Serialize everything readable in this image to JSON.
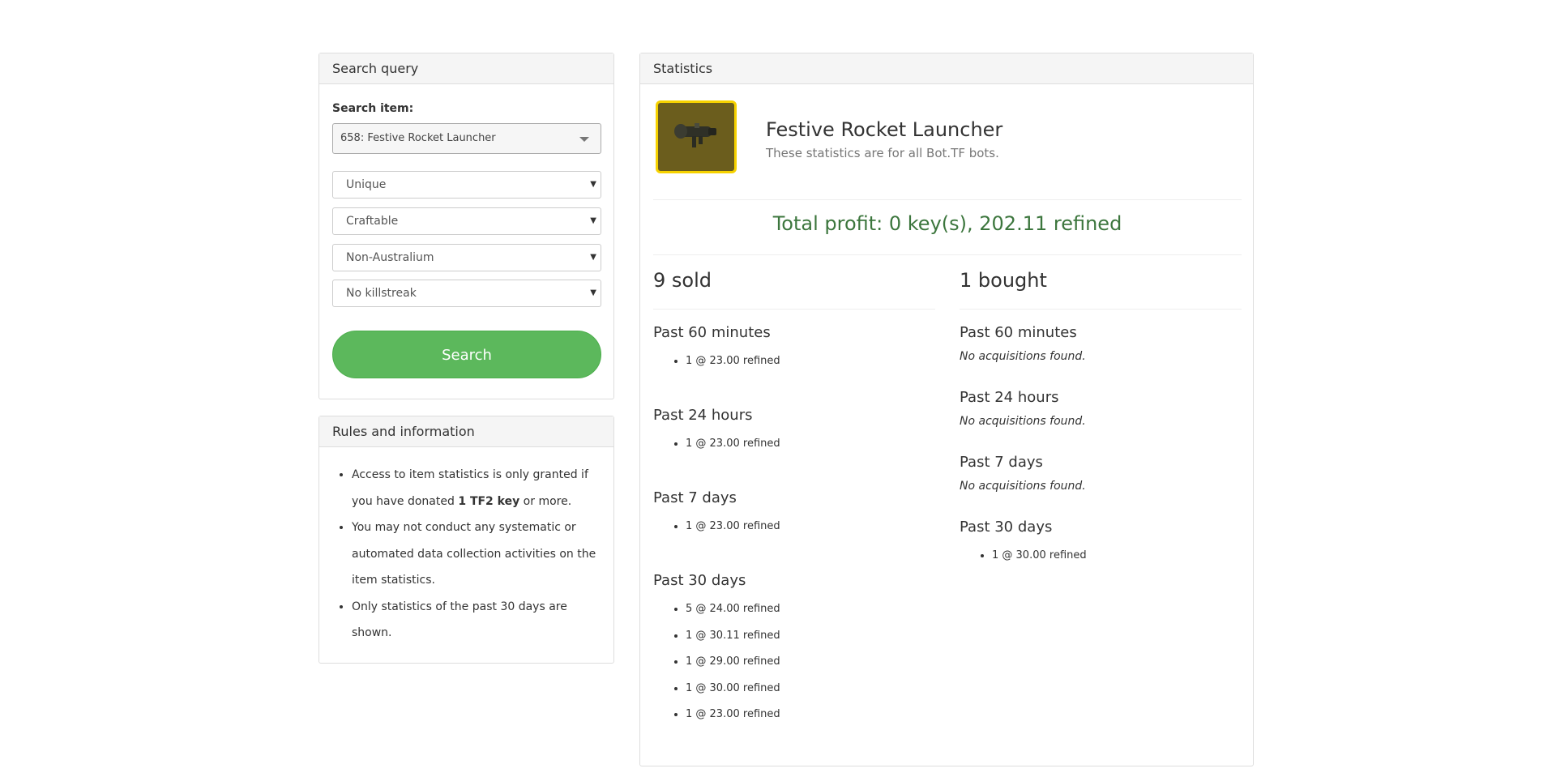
{
  "search_panel": {
    "heading": "Search query",
    "item_label": "Search item:",
    "item_value": "658: Festive Rocket Launcher",
    "quality": "Unique",
    "craftable": "Craftable",
    "australium": "Non-Australium",
    "killstreak": "No killstreak",
    "search_button": "Search"
  },
  "rules_panel": {
    "heading": "Rules and information",
    "rule1_pre": "Access to item statistics is only granted if you have donated ",
    "rule1_bold": "1 TF2 key",
    "rule1_post": " or more.",
    "rule2": "You may not conduct any systematic or automated data collection activities on the item statistics.",
    "rule3": "Only statistics of the past 30 days are shown."
  },
  "stats_panel": {
    "heading": "Statistics",
    "item_name": "Festive Rocket Launcher",
    "subtitle": "These statistics are for all Bot.TF bots.",
    "total_profit": "Total profit: 0 key(s), 202.11 refined",
    "sold": {
      "heading": "9 sold",
      "p60_title": "Past 60 minutes",
      "p60": [
        "1 @ 23.00 refined"
      ],
      "p24_title": "Past 24 hours",
      "p24": [
        "1 @ 23.00 refined"
      ],
      "p7_title": "Past 7 days",
      "p7": [
        "1 @ 23.00 refined"
      ],
      "p30_title": "Past 30 days",
      "p30": [
        "5 @ 24.00 refined",
        "1 @ 30.11 refined",
        "1 @ 29.00 refined",
        "1 @ 30.00 refined",
        "1 @ 23.00 refined"
      ]
    },
    "bought": {
      "heading": "1 bought",
      "p60_title": "Past 60 minutes",
      "p60_empty": "No acquisitions found.",
      "p24_title": "Past 24 hours",
      "p24_empty": "No acquisitions found.",
      "p7_title": "Past 7 days",
      "p7_empty": "No acquisitions found.",
      "p30_title": "Past 30 days",
      "p30": [
        "1 @ 30.00 refined"
      ]
    }
  },
  "colors": {
    "search_button": "#5cb85c",
    "profit_text": "#3c763d",
    "item_border": "#f6d200"
  },
  "icons": {
    "item_image": "rocket-launcher-icon",
    "dropdown": "chevron-down-icon"
  }
}
